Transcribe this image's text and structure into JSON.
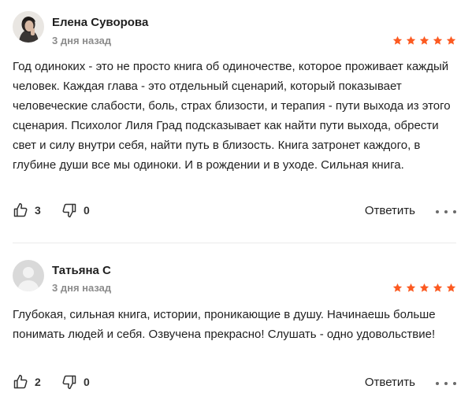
{
  "colors": {
    "star": "#fc5a21",
    "avatar_placeholder": "#d9d9d9"
  },
  "reviews": [
    {
      "author": "Елена Суворова",
      "date": "3 дня назад",
      "rating": 5,
      "avatar": "photo-avatar",
      "text": "Год одиноких - это не просто книга об одиночестве, которое проживает каждый человек. Каждая глава - это отдельный сценарий, который показывает человеческие слабости, боль, страх близости, и терапия - пути выхода из этого сценария. Психолог Лиля Град подсказывает как найти пути выхода, обрести свет и силу внутри себя, найти путь в близость. Книга затронет каждого, в глубине души все мы одиноки. И в рождении и в уходе. Сильная книга.",
      "likes": "3",
      "dislikes": "0",
      "reply_label": "Ответить"
    },
    {
      "author": "Татьяна С",
      "date": "3 дня назад",
      "rating": 5,
      "avatar": "default-user-avatar",
      "text": "Глубокая, сильная книга, истории, проникающие в душу. Начинаешь больше понимать людей и себя. Озвучена прекрасно! Слушать - одно удовольствие!",
      "likes": "2",
      "dislikes": "0",
      "reply_label": "Ответить"
    }
  ]
}
